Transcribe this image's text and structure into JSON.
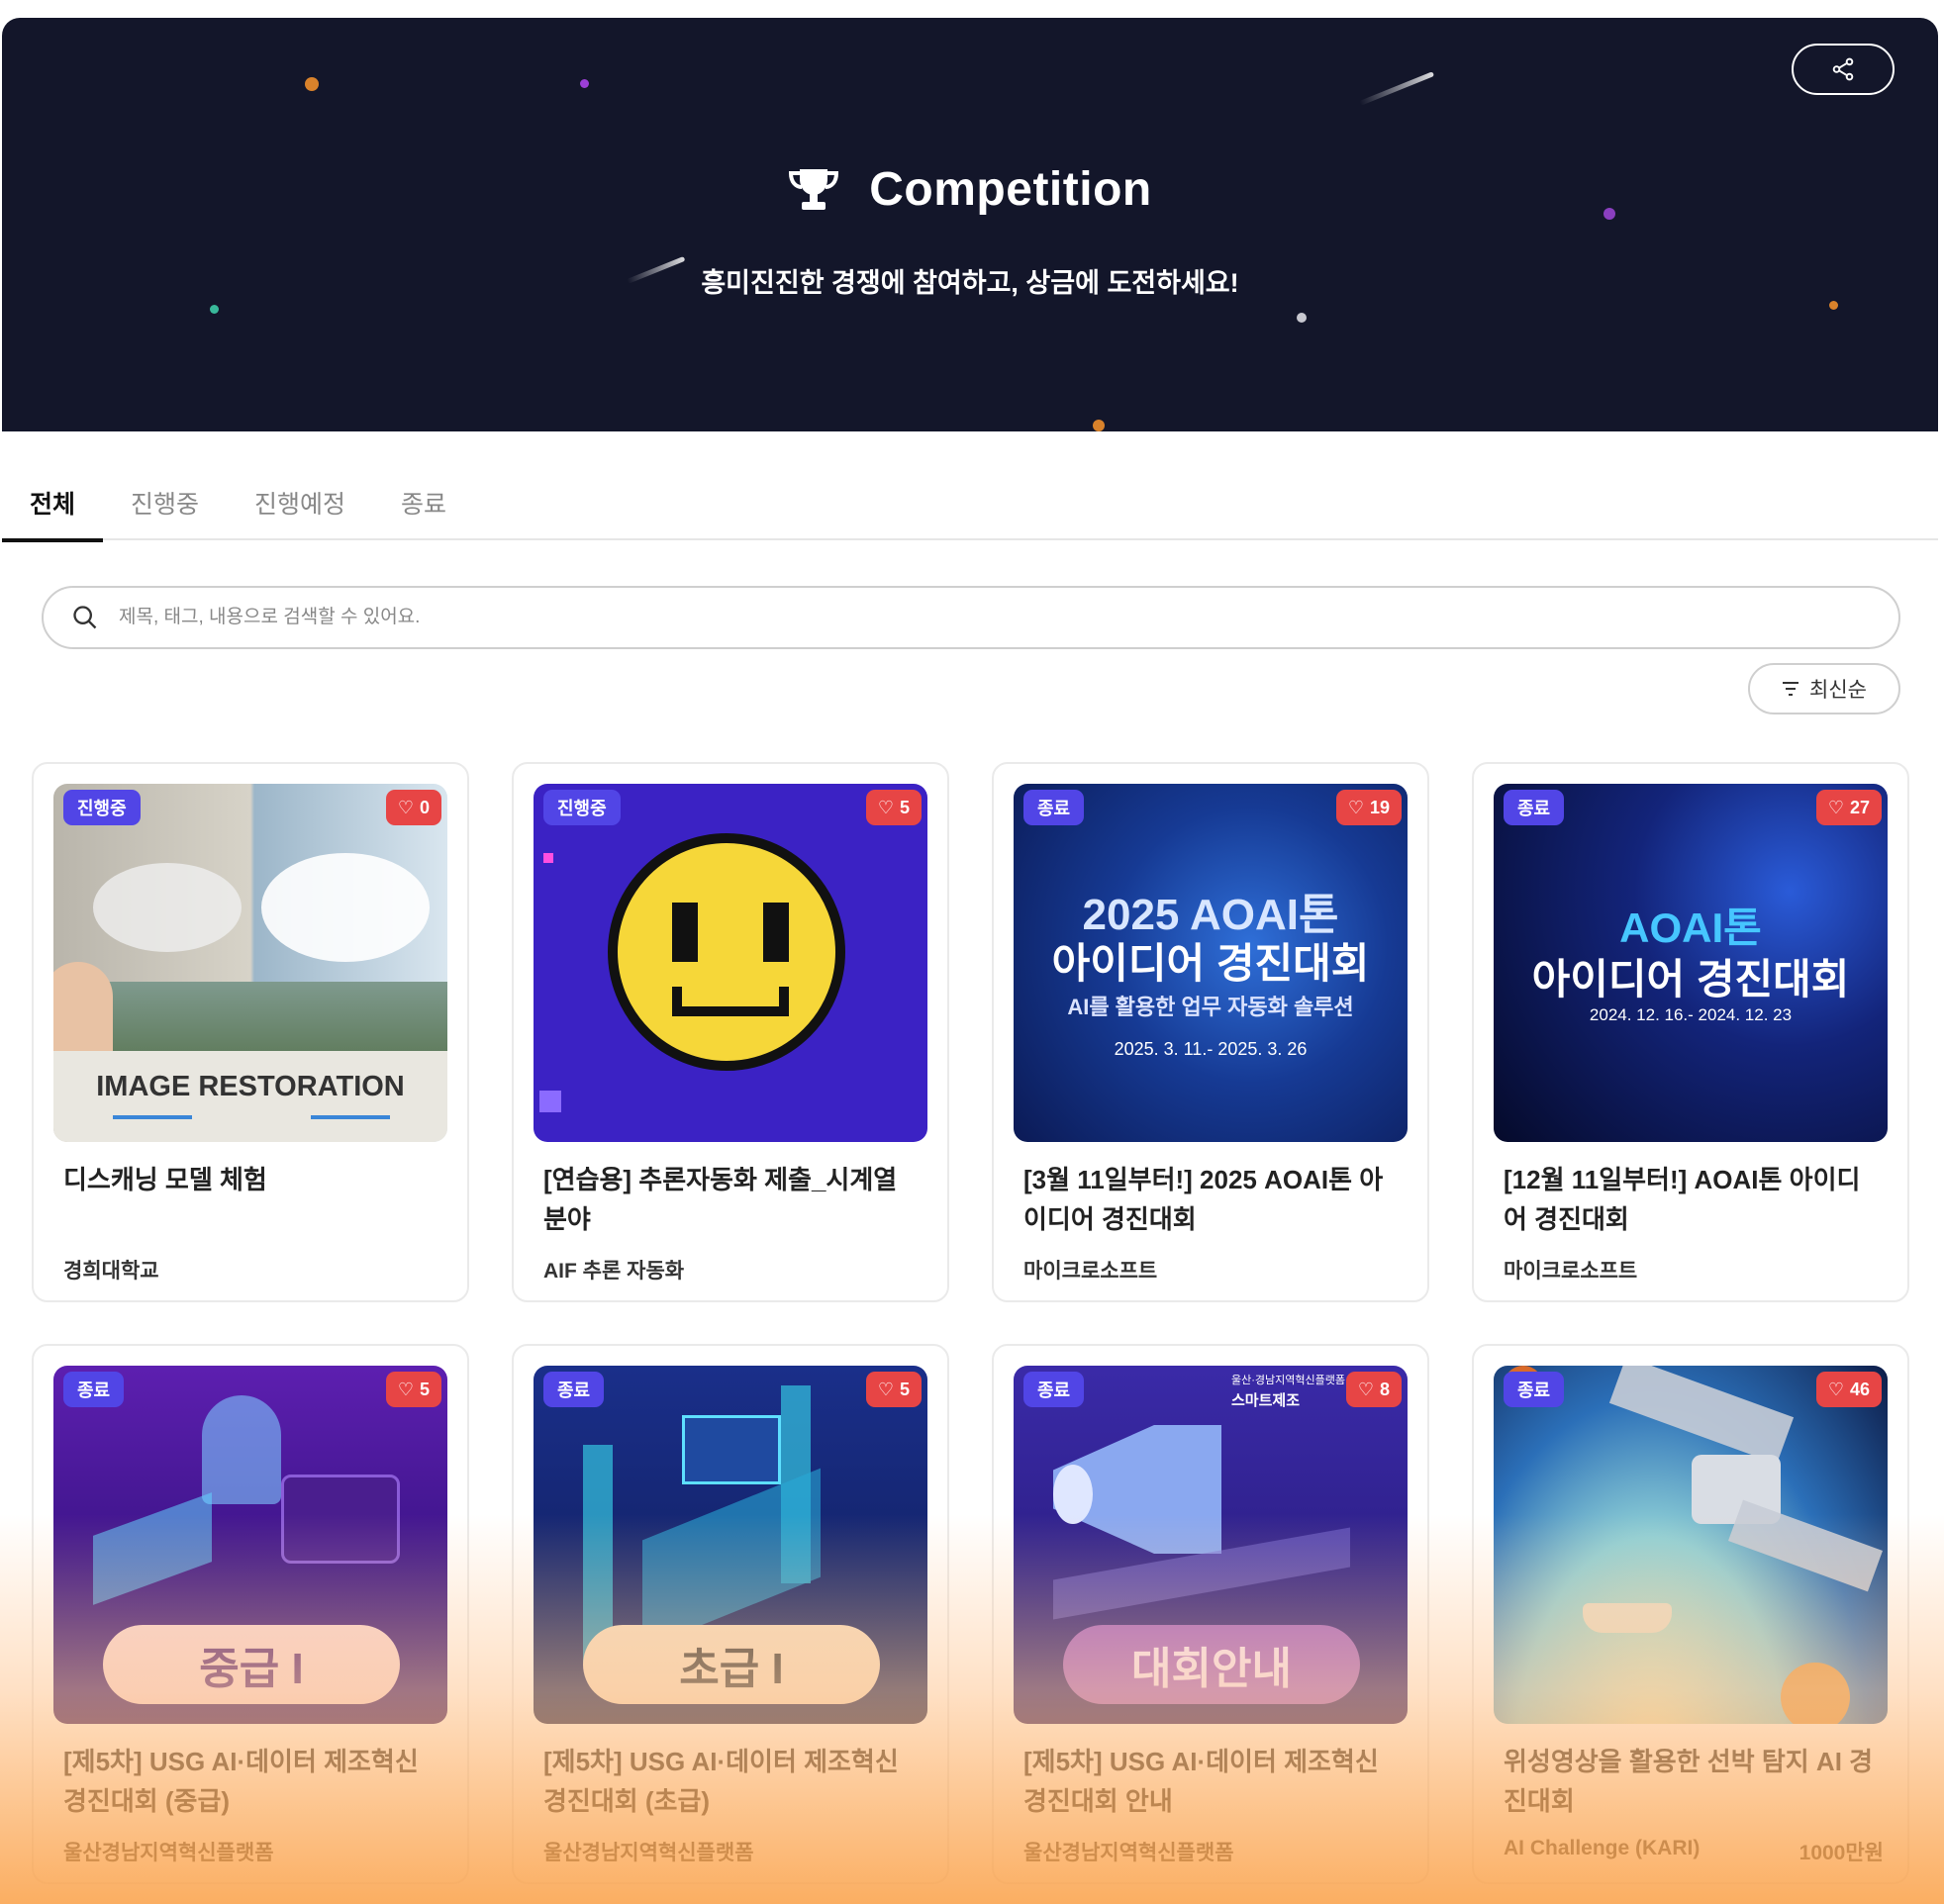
{
  "hero": {
    "title": "Competition",
    "subtitle": "흥미진진한 경쟁에 참여하고, 상금에 도전하세요!"
  },
  "tabs": [
    "전체",
    "진행중",
    "진행예정",
    "종료"
  ],
  "active_tab": "전체",
  "search": {
    "placeholder": "제목, 태그, 내용으로 검색할 수 있어요."
  },
  "sort": {
    "label": "최신순"
  },
  "cards": [
    {
      "status": "진행중",
      "likes": "0",
      "title": "디스캐닝 모델 체험",
      "org": "경희대학교",
      "thumb_text": "IMAGE RESTORATION"
    },
    {
      "status": "진행중",
      "likes": "5",
      "title": "[연습용] 추론자동화 제출_시계열 분야",
      "org": "AIF 추론 자동화"
    },
    {
      "status": "종료",
      "likes": "19",
      "title": "[3월 11일부터!] 2025 AOAI톤 아이디어 경진대회",
      "org": "마이크로소프트",
      "thumb_lines": [
        "2025 AOAI톤",
        "아이디어 경진대회",
        "AI를 활용한 업무 자동화 솔루션",
        "2025. 3. 11.- 2025. 3. 26"
      ]
    },
    {
      "status": "종료",
      "likes": "27",
      "title": "[12월 11일부터!] AOAI톤 아이디어 경진대회",
      "org": "마이크로소프트",
      "thumb_lines": [
        "AOAI톤",
        "아이디어 경진대회",
        "2024. 12. 16.- 2024. 12. 23"
      ]
    },
    {
      "status": "종료",
      "likes": "5",
      "title": "[제5차] USG AI·데이터 제조혁신 경진대회 (중급)",
      "org": "울산경남지역혁신플랫폼",
      "pill": "중급 I"
    },
    {
      "status": "종료",
      "likes": "5",
      "title": "[제5차] USG AI·데이터 제조혁신 경진대회 (초급)",
      "org": "울산경남지역혁신플랫폼",
      "pill": "초급 I"
    },
    {
      "status": "종료",
      "likes": "8",
      "title": "[제5차] USG AI·데이터 제조혁신 경진대회 안내",
      "org": "울산경남지역혁신플랫폼",
      "pill": "대회안내",
      "thumb_lines": [
        "울산·경남지역혁신플랫폼",
        "스마트제조"
      ]
    },
    {
      "status": "종료",
      "likes": "46",
      "title": "위성영상을 활용한 선박 탐지 AI 경진대회",
      "org": "AI Challenge (KARI)",
      "prize": "1000만원"
    }
  ],
  "colors": {
    "status_badge": "#5145e6",
    "like_badge": "#e74545",
    "hero_bg": "#13162a"
  }
}
